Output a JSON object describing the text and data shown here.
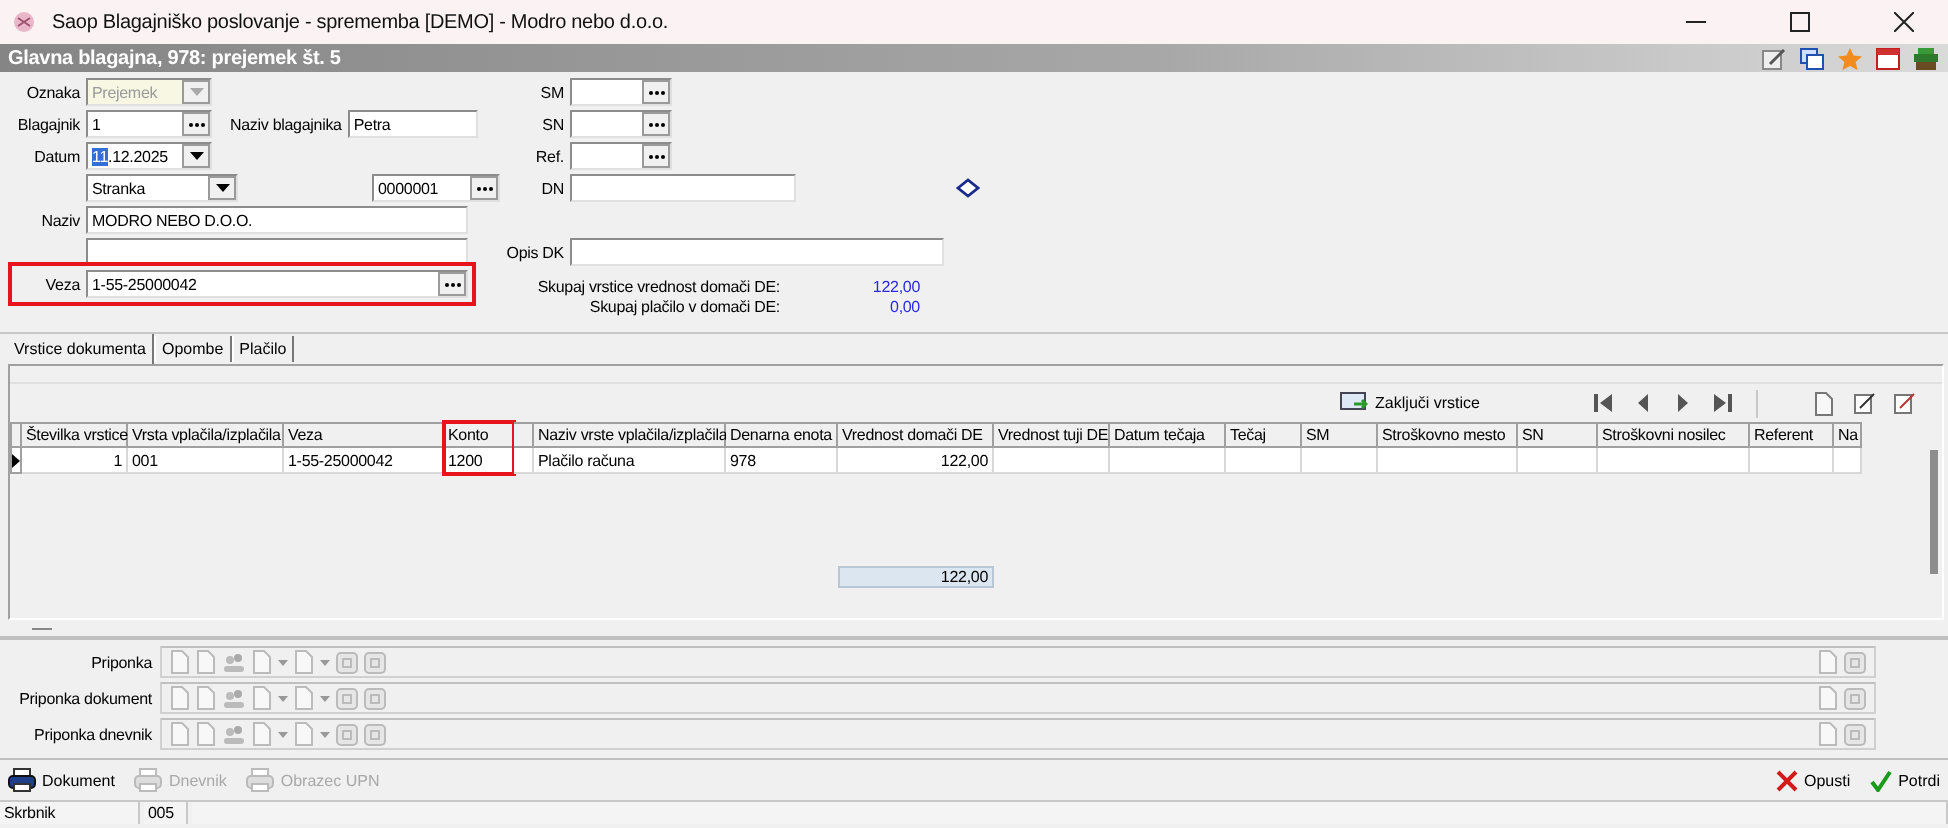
{
  "window": {
    "title": "Saop Blagajniško poslovanje - sprememba [DEMO] - Modro nebo d.o.o."
  },
  "header": {
    "title": "Glavna blagajna, 978: prejemek št. 5"
  },
  "form": {
    "oznaka": {
      "label": "Oznaka",
      "value": "Prejemek",
      "disabled": true
    },
    "blagajnik": {
      "label": "Blagajnik",
      "value": "1"
    },
    "naziv_blagajnika": {
      "label": "Naziv blagajnika",
      "value": "Petra"
    },
    "datum": {
      "label": "Datum",
      "value_selected": "11",
      "value_rest": ".12.2025"
    },
    "partner_type": {
      "value": "Stranka"
    },
    "partner_code": {
      "value": "0000001"
    },
    "naziv": {
      "label": "Naziv",
      "value": "MODRO NEBO D.O.O."
    },
    "veza": {
      "label": "Veza",
      "value": "1-55-25000042",
      "highlighted": true
    },
    "sm": {
      "label": "SM"
    },
    "sn": {
      "label": "SN"
    },
    "ref": {
      "label": "Ref."
    },
    "dn": {
      "label": "DN"
    },
    "opis_dk": {
      "label": "Opis DK"
    }
  },
  "totals": [
    {
      "label": "Skupaj vrstice vrednost domači DE:",
      "value": "122,00"
    },
    {
      "label": "Skupaj plačilo v domači DE:",
      "value": "0,00"
    }
  ],
  "tabs": [
    {
      "label": "Vrstice dokumenta",
      "selected": true
    },
    {
      "label": "Opombe",
      "selected": false
    },
    {
      "label": "Plačilo",
      "selected": false
    }
  ],
  "grid_toolbar": {
    "close_rows": "Zaključi vrstice"
  },
  "table": {
    "columns": [
      {
        "label": "Številka vrstice",
        "highlighted": false
      },
      {
        "label": "Vrsta vplačila/izplačila",
        "highlighted": false
      },
      {
        "label": "Veza",
        "highlighted": false
      },
      {
        "label": "Konto",
        "highlighted": true
      },
      {
        "highlighted": false
      },
      {
        "label": "Naziv vrste vplačila/izplačila",
        "highlighted": false
      },
      {
        "label": "Denarna enota",
        "highlighted": false
      },
      {
        "label": "Vrednost domači DE",
        "highlighted": false
      },
      {
        "label": "Vrednost tuji DE",
        "highlighted": false
      },
      {
        "label": "Datum tečaja",
        "highlighted": false
      },
      {
        "label": "Tečaj",
        "highlighted": false
      },
      {
        "label": "SM",
        "highlighted": false
      },
      {
        "label": "Stroškovno mesto",
        "highlighted": false
      },
      {
        "label": "SN",
        "highlighted": false
      },
      {
        "label": "Stroškovni nosilec",
        "highlighted": false
      },
      {
        "label": "Referent",
        "highlighted": false
      },
      {
        "label": "Na",
        "highlighted": false
      }
    ],
    "rows": [
      {
        "selected": true,
        "cells": [
          "1",
          "001",
          "1-55-25000042",
          "1200",
          null,
          "Plačilo računa",
          "978",
          "122,00",
          null,
          null,
          null,
          null,
          null,
          null,
          null,
          null,
          null
        ]
      }
    ],
    "total": "122,00"
  },
  "attachments": [
    {
      "label": "Priponka"
    },
    {
      "label": "Priponka dokument"
    },
    {
      "label": "Priponka dnevnik"
    }
  ],
  "actions": [
    {
      "label": "Dokument",
      "disabled": false
    },
    {
      "label": "Dnevnik",
      "disabled": true
    },
    {
      "label": "Obrazec UPN",
      "disabled": true
    }
  ],
  "dialog_buttons": [
    {
      "label": "Opusti",
      "kind": "cancel"
    },
    {
      "label": "Potrdi",
      "kind": "confirm"
    }
  ],
  "status_bar": {
    "user_label": "Skrbnik",
    "user_code": "005"
  }
}
